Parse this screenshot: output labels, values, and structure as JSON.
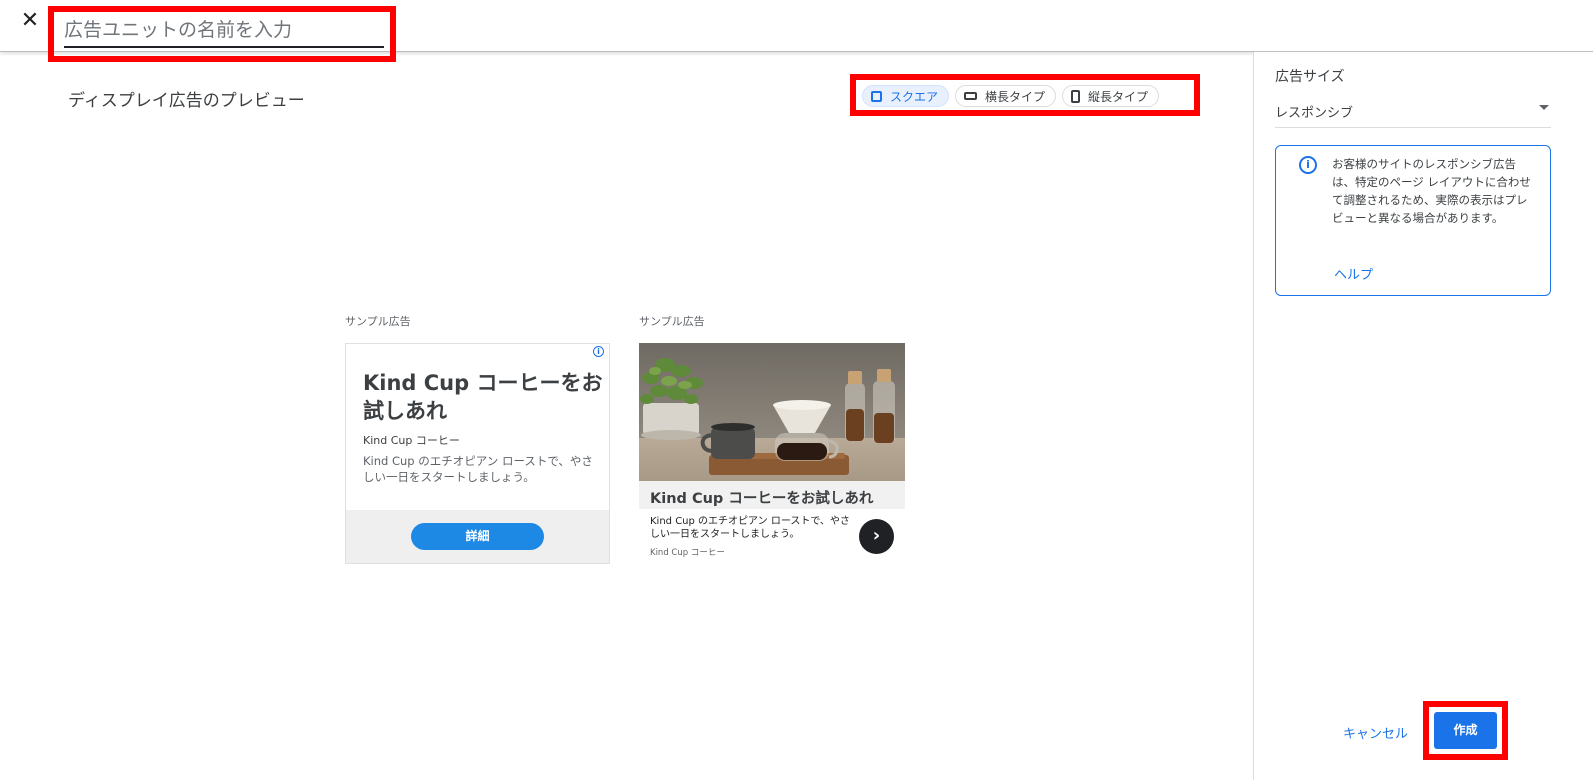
{
  "header": {
    "name_placeholder": "広告ユニットの名前を入力"
  },
  "preview": {
    "title": "ディスプレイ広告のプレビュー",
    "formats": [
      {
        "label": "スクエア",
        "selected": true
      },
      {
        "label": "横長タイプ",
        "selected": false
      },
      {
        "label": "縦長タイプ",
        "selected": false
      }
    ]
  },
  "ad_square": {
    "sample_label": "サンプル広告",
    "headline": "Kind Cup コーヒーをお試しあれ",
    "brand": "Kind Cup コーヒー",
    "description": "Kind Cup のエチオピアン ローストで、やさしい一日をスタートしましょう。",
    "button": "詳細",
    "info_glyph": "i"
  },
  "ad_image": {
    "sample_label": "サンプル広告",
    "headline": "Kind Cup コーヒーをお試しあれ",
    "description": "Kind Cup のエチオピアン ローストで、やさしい一日をスタートしましょう。",
    "brand": "Kind Cup コーヒー",
    "arrow_glyph": "›"
  },
  "sidebar": {
    "title": "広告サイズ",
    "size_value": "レスポンシブ",
    "info_text": "お客様のサイトのレスポンシブ広告は、特定のページ レイアウトに合わせて調整されるため、実際の表示はプレビューと異なる場合があります。",
    "info_glyph": "i",
    "help_link": "ヘルプ",
    "cancel": "キャンセル",
    "create": "作成"
  },
  "colors": {
    "accent": "#1a73e8",
    "highlight_border": "#ff0000",
    "ad_button": "#1e88e5"
  },
  "icons": {
    "close": "close-icon",
    "dropdown": "chevron-down-icon",
    "info": "info-icon",
    "next": "chevron-right-icon"
  }
}
